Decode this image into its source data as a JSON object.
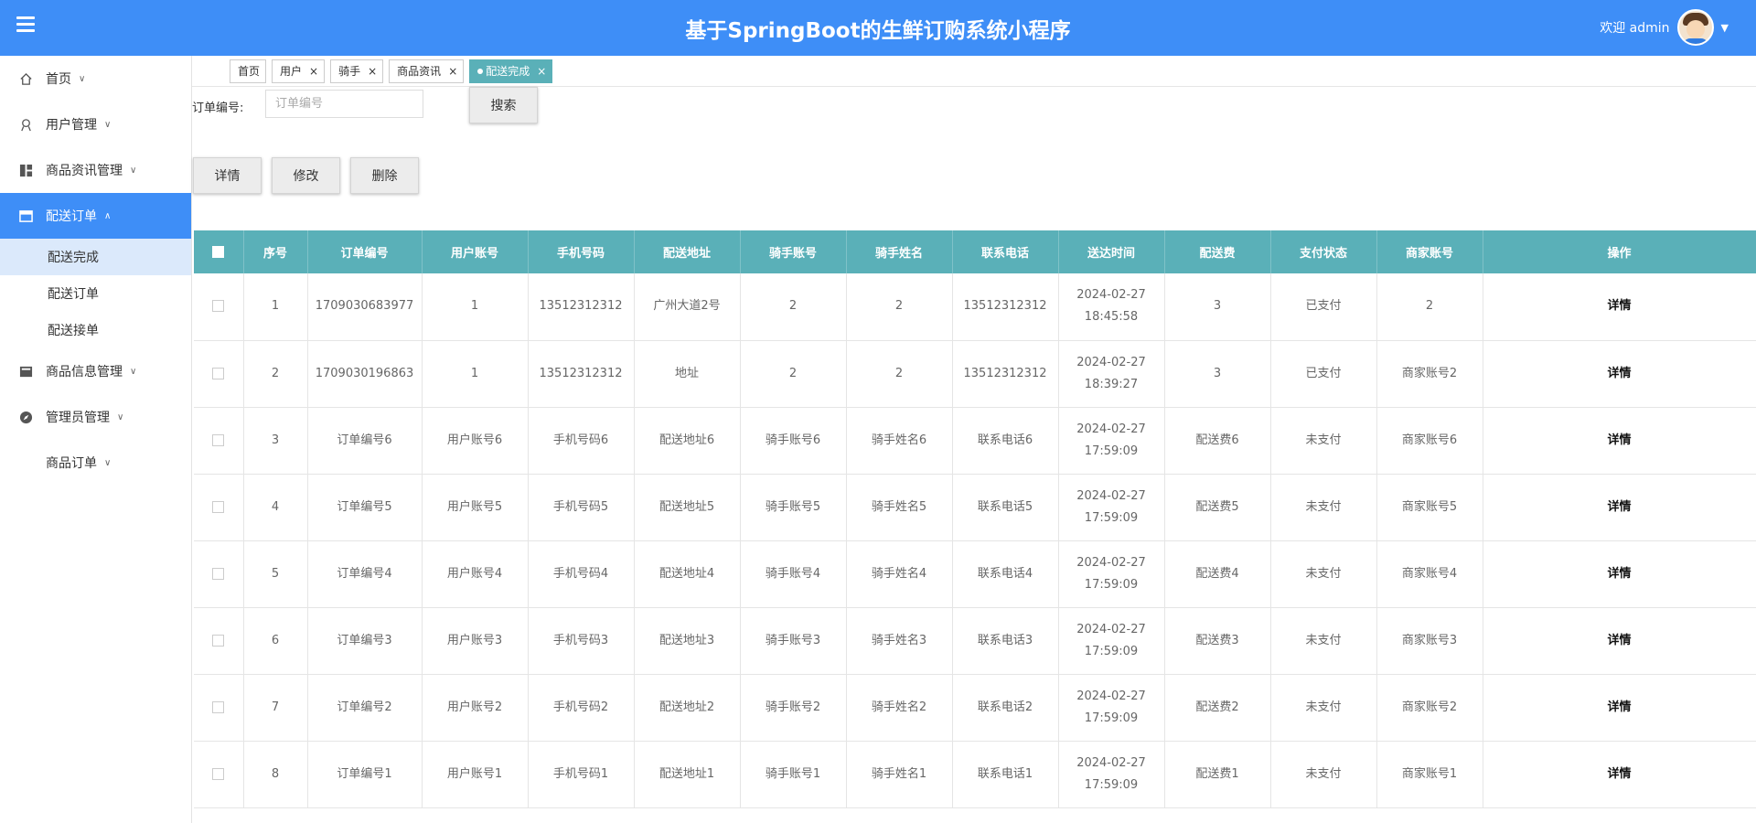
{
  "header": {
    "title": "基于SpringBoot的生鲜订购系统小程序",
    "welcome": "欢迎 admin"
  },
  "sidebar": {
    "items": [
      {
        "label": "首页",
        "icon": "home-icon"
      },
      {
        "label": "用户管理",
        "icon": "user-icon"
      },
      {
        "label": "商品资讯管理",
        "icon": "dashboard-icon"
      },
      {
        "label": "配送订单",
        "icon": "order-icon"
      },
      {
        "label": "商品信息管理",
        "icon": "product-icon"
      },
      {
        "label": "管理员管理",
        "icon": "compass-icon"
      },
      {
        "label": "商品订单",
        "icon": ""
      }
    ],
    "subitems": [
      "配送完成",
      "配送订单",
      "配送接单"
    ]
  },
  "tabs": [
    "首页",
    "用户",
    "骑手",
    "商品资讯",
    "配送完成"
  ],
  "search": {
    "label": "订单编号:",
    "placeholder": "订单编号",
    "button": "搜索"
  },
  "actions": {
    "detail": "详情",
    "edit": "修改",
    "delete": "删除"
  },
  "table": {
    "columns": [
      "序号",
      "订单编号",
      "用户账号",
      "手机号码",
      "配送地址",
      "骑手账号",
      "骑手姓名",
      "联系电话",
      "送达时间",
      "配送费",
      "支付状态",
      "商家账号",
      "操作"
    ],
    "rows": [
      [
        "1",
        "1709030683977",
        "1",
        "13512312312",
        "广州大道2号",
        "2",
        "2",
        "13512312312",
        "2024-02-27 18:45:58",
        "3",
        "已支付",
        "2",
        "详情"
      ],
      [
        "2",
        "1709030196863",
        "1",
        "13512312312",
        "地址",
        "2",
        "2",
        "13512312312",
        "2024-02-27 18:39:27",
        "3",
        "已支付",
        "商家账号2",
        "详情"
      ],
      [
        "3",
        "订单编号6",
        "用户账号6",
        "手机号码6",
        "配送地址6",
        "骑手账号6",
        "骑手姓名6",
        "联系电话6",
        "2024-02-27 17:59:09",
        "配送费6",
        "未支付",
        "商家账号6",
        "详情"
      ],
      [
        "4",
        "订单编号5",
        "用户账号5",
        "手机号码5",
        "配送地址5",
        "骑手账号5",
        "骑手姓名5",
        "联系电话5",
        "2024-02-27 17:59:09",
        "配送费5",
        "未支付",
        "商家账号5",
        "详情"
      ],
      [
        "5",
        "订单编号4",
        "用户账号4",
        "手机号码4",
        "配送地址4",
        "骑手账号4",
        "骑手姓名4",
        "联系电话4",
        "2024-02-27 17:59:09",
        "配送费4",
        "未支付",
        "商家账号4",
        "详情"
      ],
      [
        "6",
        "订单编号3",
        "用户账号3",
        "手机号码3",
        "配送地址3",
        "骑手账号3",
        "骑手姓名3",
        "联系电话3",
        "2024-02-27 17:59:09",
        "配送费3",
        "未支付",
        "商家账号3",
        "详情"
      ],
      [
        "7",
        "订单编号2",
        "用户账号2",
        "手机号码2",
        "配送地址2",
        "骑手账号2",
        "骑手姓名2",
        "联系电话2",
        "2024-02-27 17:59:09",
        "配送费2",
        "未支付",
        "商家账号2",
        "详情"
      ],
      [
        "8",
        "订单编号1",
        "用户账号1",
        "手机号码1",
        "配送地址1",
        "骑手账号1",
        "骑手姓名1",
        "联系电话1",
        "2024-02-27 17:59:09",
        "配送费1",
        "未支付",
        "商家账号1",
        "详情"
      ]
    ]
  },
  "colors": {
    "header": "#3e8ef7",
    "table_header": "#5ab0b8",
    "active_tab": "#5ab0b8"
  }
}
